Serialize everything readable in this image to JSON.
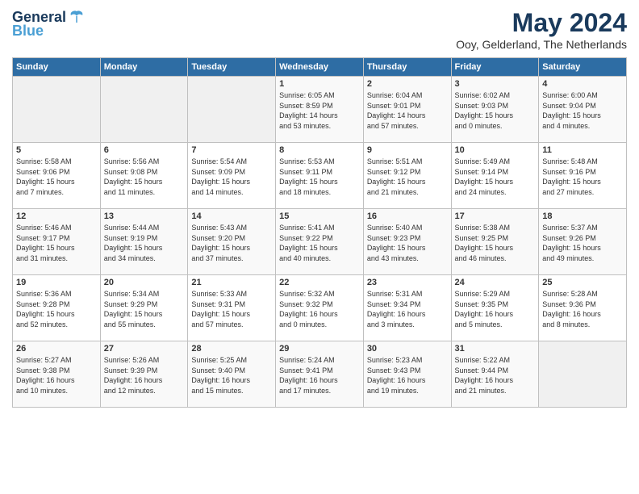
{
  "logo": {
    "line1": "General",
    "line2": "Blue"
  },
  "title": "May 2024",
  "location": "Ooy, Gelderland, The Netherlands",
  "days_of_week": [
    "Sunday",
    "Monday",
    "Tuesday",
    "Wednesday",
    "Thursday",
    "Friday",
    "Saturday"
  ],
  "weeks": [
    [
      {
        "day": "",
        "info": ""
      },
      {
        "day": "",
        "info": ""
      },
      {
        "day": "",
        "info": ""
      },
      {
        "day": "1",
        "info": "Sunrise: 6:05 AM\nSunset: 8:59 PM\nDaylight: 14 hours\nand 53 minutes."
      },
      {
        "day": "2",
        "info": "Sunrise: 6:04 AM\nSunset: 9:01 PM\nDaylight: 14 hours\nand 57 minutes."
      },
      {
        "day": "3",
        "info": "Sunrise: 6:02 AM\nSunset: 9:03 PM\nDaylight: 15 hours\nand 0 minutes."
      },
      {
        "day": "4",
        "info": "Sunrise: 6:00 AM\nSunset: 9:04 PM\nDaylight: 15 hours\nand 4 minutes."
      }
    ],
    [
      {
        "day": "5",
        "info": "Sunrise: 5:58 AM\nSunset: 9:06 PM\nDaylight: 15 hours\nand 7 minutes."
      },
      {
        "day": "6",
        "info": "Sunrise: 5:56 AM\nSunset: 9:08 PM\nDaylight: 15 hours\nand 11 minutes."
      },
      {
        "day": "7",
        "info": "Sunrise: 5:54 AM\nSunset: 9:09 PM\nDaylight: 15 hours\nand 14 minutes."
      },
      {
        "day": "8",
        "info": "Sunrise: 5:53 AM\nSunset: 9:11 PM\nDaylight: 15 hours\nand 18 minutes."
      },
      {
        "day": "9",
        "info": "Sunrise: 5:51 AM\nSunset: 9:12 PM\nDaylight: 15 hours\nand 21 minutes."
      },
      {
        "day": "10",
        "info": "Sunrise: 5:49 AM\nSunset: 9:14 PM\nDaylight: 15 hours\nand 24 minutes."
      },
      {
        "day": "11",
        "info": "Sunrise: 5:48 AM\nSunset: 9:16 PM\nDaylight: 15 hours\nand 27 minutes."
      }
    ],
    [
      {
        "day": "12",
        "info": "Sunrise: 5:46 AM\nSunset: 9:17 PM\nDaylight: 15 hours\nand 31 minutes."
      },
      {
        "day": "13",
        "info": "Sunrise: 5:44 AM\nSunset: 9:19 PM\nDaylight: 15 hours\nand 34 minutes."
      },
      {
        "day": "14",
        "info": "Sunrise: 5:43 AM\nSunset: 9:20 PM\nDaylight: 15 hours\nand 37 minutes."
      },
      {
        "day": "15",
        "info": "Sunrise: 5:41 AM\nSunset: 9:22 PM\nDaylight: 15 hours\nand 40 minutes."
      },
      {
        "day": "16",
        "info": "Sunrise: 5:40 AM\nSunset: 9:23 PM\nDaylight: 15 hours\nand 43 minutes."
      },
      {
        "day": "17",
        "info": "Sunrise: 5:38 AM\nSunset: 9:25 PM\nDaylight: 15 hours\nand 46 minutes."
      },
      {
        "day": "18",
        "info": "Sunrise: 5:37 AM\nSunset: 9:26 PM\nDaylight: 15 hours\nand 49 minutes."
      }
    ],
    [
      {
        "day": "19",
        "info": "Sunrise: 5:36 AM\nSunset: 9:28 PM\nDaylight: 15 hours\nand 52 minutes."
      },
      {
        "day": "20",
        "info": "Sunrise: 5:34 AM\nSunset: 9:29 PM\nDaylight: 15 hours\nand 55 minutes."
      },
      {
        "day": "21",
        "info": "Sunrise: 5:33 AM\nSunset: 9:31 PM\nDaylight: 15 hours\nand 57 minutes."
      },
      {
        "day": "22",
        "info": "Sunrise: 5:32 AM\nSunset: 9:32 PM\nDaylight: 16 hours\nand 0 minutes."
      },
      {
        "day": "23",
        "info": "Sunrise: 5:31 AM\nSunset: 9:34 PM\nDaylight: 16 hours\nand 3 minutes."
      },
      {
        "day": "24",
        "info": "Sunrise: 5:29 AM\nSunset: 9:35 PM\nDaylight: 16 hours\nand 5 minutes."
      },
      {
        "day": "25",
        "info": "Sunrise: 5:28 AM\nSunset: 9:36 PM\nDaylight: 16 hours\nand 8 minutes."
      }
    ],
    [
      {
        "day": "26",
        "info": "Sunrise: 5:27 AM\nSunset: 9:38 PM\nDaylight: 16 hours\nand 10 minutes."
      },
      {
        "day": "27",
        "info": "Sunrise: 5:26 AM\nSunset: 9:39 PM\nDaylight: 16 hours\nand 12 minutes."
      },
      {
        "day": "28",
        "info": "Sunrise: 5:25 AM\nSunset: 9:40 PM\nDaylight: 16 hours\nand 15 minutes."
      },
      {
        "day": "29",
        "info": "Sunrise: 5:24 AM\nSunset: 9:41 PM\nDaylight: 16 hours\nand 17 minutes."
      },
      {
        "day": "30",
        "info": "Sunrise: 5:23 AM\nSunset: 9:43 PM\nDaylight: 16 hours\nand 19 minutes."
      },
      {
        "day": "31",
        "info": "Sunrise: 5:22 AM\nSunset: 9:44 PM\nDaylight: 16 hours\nand 21 minutes."
      },
      {
        "day": "",
        "info": ""
      }
    ]
  ]
}
